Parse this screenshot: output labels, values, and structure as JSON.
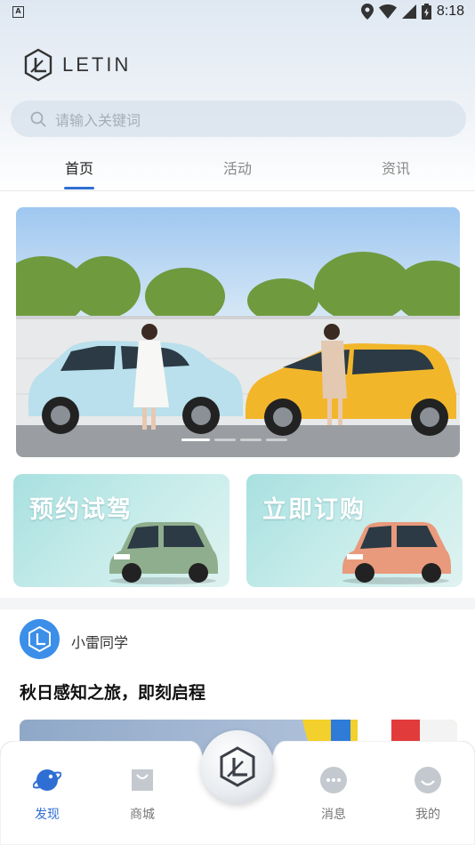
{
  "status_bar": {
    "time": "8:18",
    "notification_badge": "A"
  },
  "brand": {
    "name": "LETIN"
  },
  "search": {
    "placeholder": "请输入关键词"
  },
  "tabs": [
    {
      "label": "首页",
      "active": true
    },
    {
      "label": "活动",
      "active": false
    },
    {
      "label": "资讯",
      "active": false
    }
  ],
  "banner": {
    "slide_count": 4,
    "active_slide": 1
  },
  "promos": [
    {
      "title": "预约试驾",
      "car_color": "#8fae8e"
    },
    {
      "title": "立即订购",
      "car_color": "#e99a7c"
    }
  ],
  "feed": {
    "author": "小雷同学",
    "post_title": "秋日感知之旅，即刻启程"
  },
  "bottom_nav": [
    {
      "label": "发现",
      "icon": "planet-icon",
      "active": true
    },
    {
      "label": "商城",
      "icon": "shopping-bag-icon",
      "active": false
    },
    {
      "label": "",
      "icon": "letin-logo-icon",
      "active": false
    },
    {
      "label": "消息",
      "icon": "chat-bubble-icon",
      "active": false
    },
    {
      "label": "我的",
      "icon": "profile-icon",
      "active": false
    }
  ],
  "colors": {
    "accent": "#2f6fd3",
    "inactive": "#777777",
    "promo_bg": "#bfe8e6"
  }
}
